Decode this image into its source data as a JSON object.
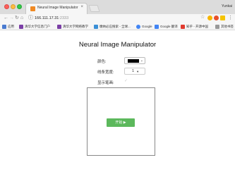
{
  "browser": {
    "tab_title": "Neural Image Manipulator",
    "tab_close": "×",
    "profile_name": "Yunkai",
    "url_host": "166.111.17.31",
    "url_port": ":2333",
    "bookmarks": [
      {
        "label": "应用",
        "color": "#4a7bd0"
      },
      {
        "label": "清华大学信息门户",
        "color": "#7b3fa6"
      },
      {
        "label": "清华大学网络教学",
        "color": "#7b3fa6"
      },
      {
        "label": "缴纳必应搜索 - 全球...",
        "color": "#3a8fd6"
      },
      {
        "label": "Google",
        "color": "#4285f4"
      },
      {
        "label": "Google 翻译",
        "color": "#4285f4"
      },
      {
        "label": "知乎 - 开源中国",
        "color": "#e03a2e"
      },
      {
        "label": "其他书签",
        "color": "#999999"
      }
    ]
  },
  "page": {
    "title": "Neural Image Manipulator",
    "color_label": "颜色:",
    "color_value": "#000000",
    "width_label": "线条宽度:",
    "width_value": "1",
    "show_label": "显示笔画:",
    "show_checked": true,
    "start_button": "开始 ▶"
  }
}
